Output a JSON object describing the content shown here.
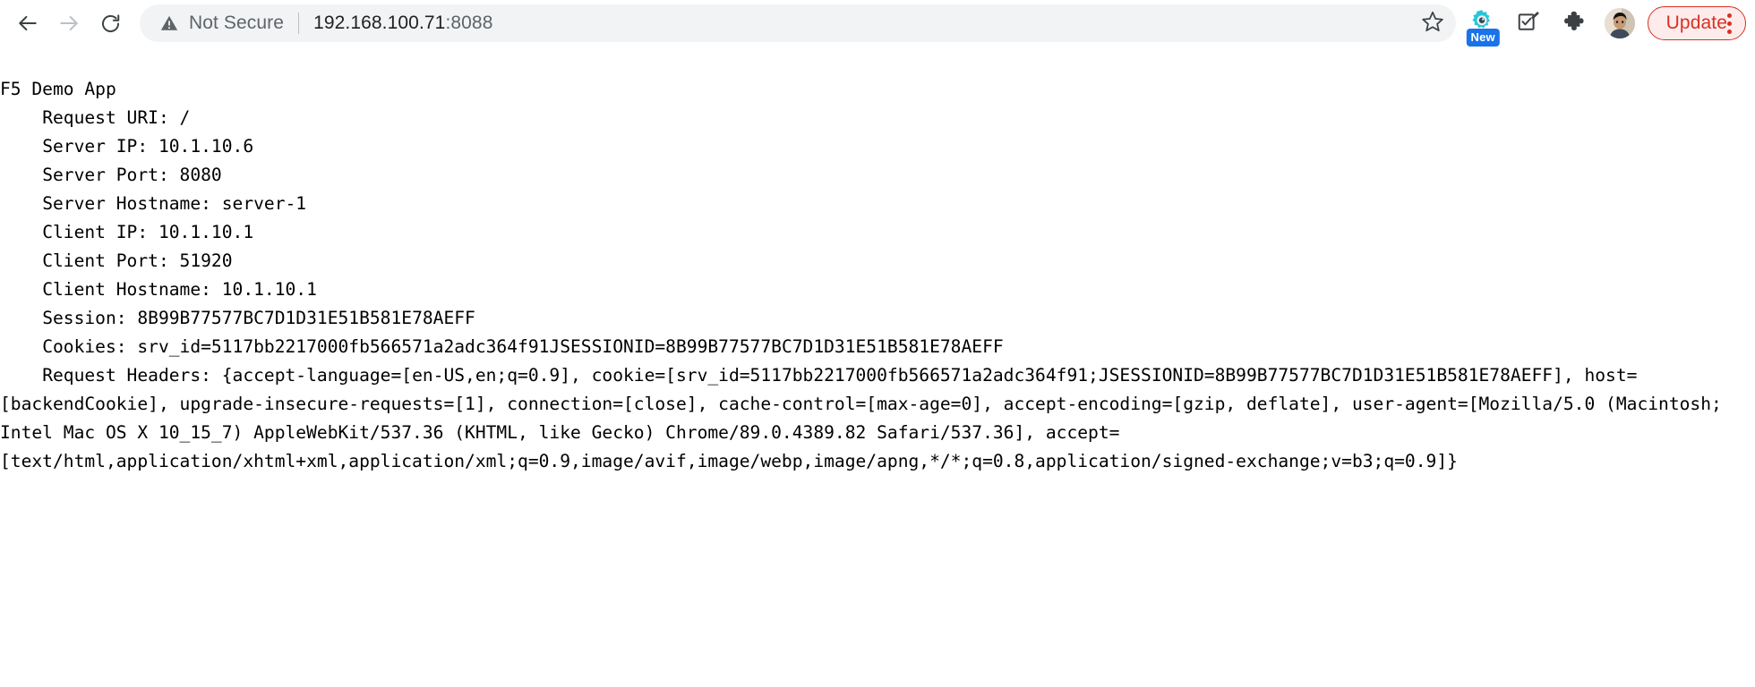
{
  "browser": {
    "back_icon": "back-arrow-icon",
    "forward_icon": "forward-arrow-icon",
    "reload_icon": "reload-icon",
    "security_warning_icon": "warning-triangle-icon",
    "security_label": "Not Secure",
    "url_host": "192.168.100.71",
    "url_port": ":8088",
    "url_full": "192.168.100.71:8088",
    "bookmark_icon": "star-icon",
    "extension_gear_icon": "gear-extension-icon",
    "extension_new_badge": "New",
    "extension_checklist_icon": "checklist-icon",
    "extensions_icon": "puzzle-piece-icon",
    "avatar_icon": "profile-avatar",
    "update_label": "Update",
    "menu_icon": "three-dot-menu-icon"
  },
  "page": {
    "title": "F5 Demo App",
    "request_uri_line": "Request URI: /",
    "server_ip_line": "Server IP: 10.1.10.6",
    "server_port_line": "Server Port: 8080",
    "server_hostname_line": "Server Hostname: server-1",
    "client_ip_line": "Client IP: 10.1.10.1",
    "client_port_line": "Client Port: 51920",
    "client_hostname_line": "Client Hostname: 10.1.10.1",
    "session_line": "Session: 8B99B77577BC7D1D31E51B581E78AEFF",
    "cookies_line": "Cookies: srv_id=5117bb2217000fb566571a2adc364f91JSESSIONID=8B99B77577BC7D1D31E51B581E78AEFF",
    "request_headers_line": "Request Headers: {accept-language=[en-US,en;q=0.9], cookie=[srv_id=5117bb2217000fb566571a2adc364f91;JSESSIONID=8B99B77577BC7D1D31E51B581E78AEFF], host=[backendCookie], upgrade-insecure-requests=[1], connection=[close], cache-control=[max-age=0], accept-encoding=[gzip, deflate], user-agent=[Mozilla/5.0 (Macintosh; Intel Mac OS X 10_15_7) AppleWebKit/537.36 (KHTML, like Gecko) Chrome/89.0.4389.82 Safari/537.36], accept=[text/html,application/xhtml+xml,application/xml;q=0.9,image/avif,image/webp,image/apng,*/*;q=0.8,application/signed-exchange;v=b3;q=0.9]}",
    "indent": "    ",
    "blank": ""
  }
}
